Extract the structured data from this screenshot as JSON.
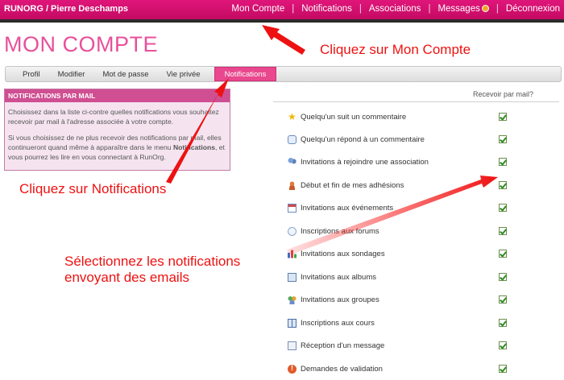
{
  "header": {
    "brand": "RUNORG / Pierre Deschamps",
    "nav": [
      "Mon Compte",
      "Notifications",
      "Associations",
      "Messages",
      "Déconnexion"
    ]
  },
  "page_title": "MON COMPTE",
  "tabs": [
    "Profil",
    "Modifier",
    "Mot de passe",
    "Vie privée",
    "Notifications"
  ],
  "active_tab": "Notifications",
  "info_box": {
    "title": "NOTIFICATIONS PAR MAIL",
    "para1": "Choisissez dans la liste ci-contre quelles notifications vous souhaitez recevoir par mail à l'adresse associée à votre compte.",
    "para2_a": "Si vous choisissez de ne plus recevoir des notifications par mail, elles continueront quand même à apparaître dans le menu ",
    "para2_bold": "Notifications",
    "para2_b": ", et vous pourrez les lire en vous connectant à RunOrg."
  },
  "list": {
    "column_header": "Recevoir par mail?",
    "items": [
      {
        "label": "Quelqu'un suit un commentaire",
        "icon": "star-icon",
        "checked": true
      },
      {
        "label": "Quelqu'un répond à un commentaire",
        "icon": "comment-icon",
        "checked": true
      },
      {
        "label": "Invitations à rejoindre une association",
        "icon": "people-icon",
        "checked": true
      },
      {
        "label": "Début et fin de mes adhésions",
        "icon": "user-icon",
        "checked": true
      },
      {
        "label": "Invitations aux événements",
        "icon": "calendar-icon",
        "checked": true
      },
      {
        "label": "Inscriptions aux forums",
        "icon": "forum-icon",
        "checked": true
      },
      {
        "label": "Invitations aux sondages",
        "icon": "poll-icon",
        "checked": true
      },
      {
        "label": "Invitations aux albums",
        "icon": "album-icon",
        "checked": true
      },
      {
        "label": "Invitations aux groupes",
        "icon": "group-icon",
        "checked": true
      },
      {
        "label": "Inscriptions aux cours",
        "icon": "book-icon",
        "checked": true
      },
      {
        "label": "Réception d'un message",
        "icon": "mail-icon",
        "checked": true
      },
      {
        "label": "Demandes de validation",
        "icon": "alert-icon",
        "checked": true
      }
    ]
  },
  "annotations": {
    "a1": "Cliquez sur Mon Compte",
    "a2": "Cliquez sur Notifications",
    "a3_line1": "Sélectionnez les notifications",
    "a3_line2": "envoyant des emails"
  },
  "colors": {
    "brand": "#d0106e",
    "accent": "#e9478e",
    "annotation": "#ee1111"
  }
}
